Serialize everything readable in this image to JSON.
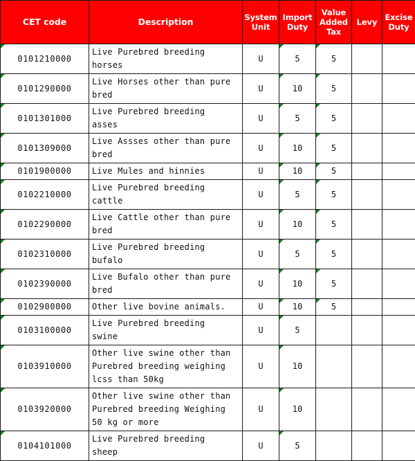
{
  "table": {
    "columns": [
      {
        "key": "cet",
        "label": "CET code"
      },
      {
        "key": "desc",
        "label": "Description"
      },
      {
        "key": "unit",
        "label": "System Unit"
      },
      {
        "key": "import",
        "label": "Import Duty"
      },
      {
        "key": "vat",
        "label": "Value Added Tax"
      },
      {
        "key": "levy",
        "label": "Levy"
      },
      {
        "key": "excise",
        "label": "Excise Duty"
      }
    ],
    "header_labels": {
      "cet": "CET code",
      "desc": "Description",
      "unit_line1": "System",
      "unit_line2": "Unit",
      "import_line1": "Import",
      "import_line2": "Duty",
      "vat_line1": "Value",
      "vat_line2": "Added",
      "vat_line3": "Tax",
      "levy": "Levy",
      "excise_line1": "Excise",
      "excise_line2": "Duty"
    },
    "rows": [
      {
        "cet": "0101210000",
        "desc": "Live Purebred breeding\nhorses",
        "unit": "U",
        "import": "5",
        "vat": "5",
        "levy": "",
        "excise": ""
      },
      {
        "cet": "0101290000",
        "desc": "Live Horses other than pure\nbred",
        "unit": "U",
        "import": "10",
        "vat": "5",
        "levy": "",
        "excise": ""
      },
      {
        "cet": "0101301000",
        "desc": "Live Purebred breeding\nasses",
        "unit": "U",
        "import": "5",
        "vat": "5",
        "levy": "",
        "excise": ""
      },
      {
        "cet": "0101309000",
        "desc": "Live Assses other than pure\nbred",
        "unit": "U",
        "import": "10",
        "vat": "5",
        "levy": "",
        "excise": ""
      },
      {
        "cet": "0101900000",
        "desc": "Live Mules and hinnies",
        "unit": "U",
        "import": "10",
        "vat": "5",
        "levy": "",
        "excise": ""
      },
      {
        "cet": "0102210000",
        "desc": "Live Purebred breeding\ncattle",
        "unit": "U",
        "import": "5",
        "vat": "5",
        "levy": "",
        "excise": ""
      },
      {
        "cet": "0102290000",
        "desc": "Live Cattle other than pure\nbred",
        "unit": "U",
        "import": "10",
        "vat": "5",
        "levy": "",
        "excise": ""
      },
      {
        "cet": "0102310000",
        "desc": "Live Purebred breeding\nbufalo",
        "unit": "U",
        "import": "5",
        "vat": "5",
        "levy": "",
        "excise": ""
      },
      {
        "cet": "0102390000",
        "desc": "Live Bufalo other than pure\nbred",
        "unit": "U",
        "import": "10",
        "vat": "5",
        "levy": "",
        "excise": ""
      },
      {
        "cet": "0102900000",
        "desc": "Other live bovine animals.",
        "unit": "U",
        "import": "10",
        "vat": "5",
        "levy": "",
        "excise": ""
      },
      {
        "cet": "0103100000",
        "desc": "Live Purebred breeding\nswine",
        "unit": "U",
        "import": "5",
        "vat": "",
        "levy": "",
        "excise": ""
      },
      {
        "cet": "0103910000",
        "desc": "Other live swine other than\nPurebred breeding weighing\nlcss than 50kg",
        "unit": "U",
        "import": "10",
        "vat": "",
        "levy": "",
        "excise": ""
      },
      {
        "cet": "0103920000",
        "desc": "Other live swine other than\nPurebred breeding Weighing\n50 kg or more",
        "unit": "U",
        "import": "10",
        "vat": "",
        "levy": "",
        "excise": ""
      },
      {
        "cet": "0104101000",
        "desc": "Live Purebred breeding\nsheep",
        "unit": "U",
        "import": "5",
        "vat": "",
        "levy": "",
        "excise": ""
      }
    ]
  },
  "colors": {
    "header_background": "#FF0000",
    "header_text": "#FFFFFF",
    "grid_line": "#1A1A1A",
    "cell_background": "#FFFFFF",
    "cell_text": "#111111",
    "marker_green": "#1A7A24"
  }
}
